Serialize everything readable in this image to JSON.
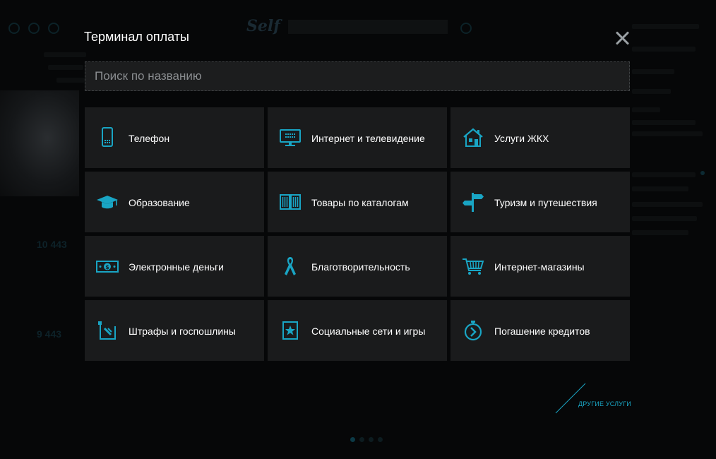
{
  "modal": {
    "title": "Терминал оплаты",
    "search_placeholder": "Поиск по названию",
    "close_label": "×",
    "other_services": "ДРУГИЕ УСЛУГИ"
  },
  "accent": "#19a5c4",
  "tiles": [
    {
      "label": "Телефон",
      "icon": "phone-icon"
    },
    {
      "label": "Интернет и телевидение",
      "icon": "monitor-icon"
    },
    {
      "label": "Услуги ЖКХ",
      "icon": "house-icon"
    },
    {
      "label": "Образование",
      "icon": "graduation-cap-icon"
    },
    {
      "label": "Товары по каталогам",
      "icon": "catalog-book-icon"
    },
    {
      "label": "Туризм и путешествия",
      "icon": "signpost-icon"
    },
    {
      "label": "Электронные деньги",
      "icon": "money-bill-icon"
    },
    {
      "label": "Благотворительность",
      "icon": "ribbon-icon"
    },
    {
      "label": "Интернет-магазины",
      "icon": "shopping-cart-icon"
    },
    {
      "label": "Штрафы и госпошлины",
      "icon": "fine-ticket-icon"
    },
    {
      "label": "Социальные сети и игры",
      "icon": "social-star-icon"
    },
    {
      "label": "Погашение кредитов",
      "icon": "stopwatch-icon"
    }
  ]
}
